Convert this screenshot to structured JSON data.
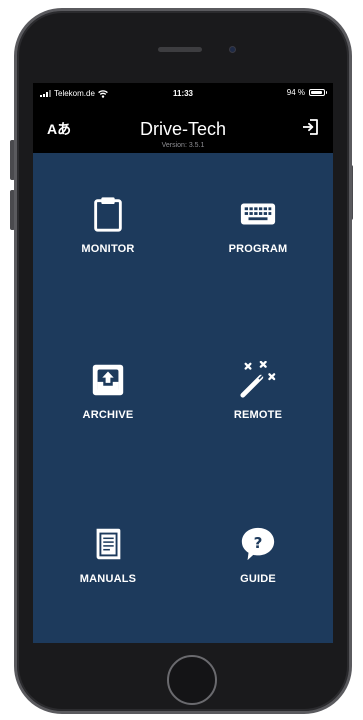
{
  "status_bar": {
    "carrier": "Telekom.de",
    "time": "11:33",
    "battery_text": "94 %",
    "battery_level": 0.94
  },
  "header": {
    "language_button_label": "Aあ",
    "title": "Drive-Tech",
    "version": "Version: 3.5.1",
    "logout_icon": "logout-icon"
  },
  "tiles": [
    {
      "label": "MONITOR",
      "icon": "clipboard-icon"
    },
    {
      "label": "PROGRAM",
      "icon": "keyboard-icon"
    },
    {
      "label": "ARCHIVE",
      "icon": "archive-upload-icon"
    },
    {
      "label": "REMOTE",
      "icon": "magic-wand-icon"
    },
    {
      "label": "MANUALS",
      "icon": "manual-book-icon"
    },
    {
      "label": "GUIDE",
      "icon": "help-bubble-icon"
    }
  ],
  "colors": {
    "tile_background": "#1d3a5c",
    "screen_background": "#000000",
    "version_text": "#8e8e93"
  }
}
